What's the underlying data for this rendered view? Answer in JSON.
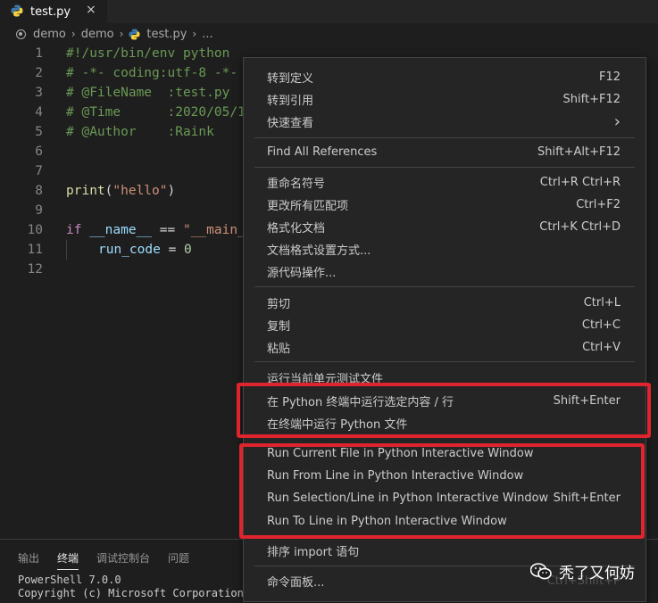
{
  "tab": {
    "title": "test.py",
    "close": "×"
  },
  "breadcrumb": {
    "items": [
      "demo",
      "demo",
      "test.py",
      "..."
    ]
  },
  "editor": {
    "line_numbers": [
      "1",
      "2",
      "3",
      "4",
      "5",
      "6",
      "7",
      "8",
      "9",
      "10",
      "11",
      "12"
    ],
    "lines": {
      "l1": "#!/usr/bin/env python",
      "l2": "# -*- coding:utf-8 -*-",
      "l3": "# @FileName  :test.py",
      "l4": "# @Time      :2020/05/1",
      "l5": "# @Author    :Raink",
      "l8_func": "print",
      "l8_open": "(",
      "l8_str": "\"hello\"",
      "l8_close": ")",
      "l10_kw": "if",
      "l10_var": "__name__",
      "l10_op": " == ",
      "l10_str": "\"__main_",
      "l11_var": "run_code",
      "l11_op": " = ",
      "l11_num": "0"
    }
  },
  "panel": {
    "tabs": [
      "输出",
      "终端",
      "调试控制台",
      "问题"
    ],
    "active_tab": "终端",
    "lines": [
      "PowerShell 7.0.0",
      "Copyright (c) Microsoft Corporation. All r"
    ]
  },
  "context_menu": {
    "items": [
      {
        "label": "转到定义",
        "shortcut": "F12"
      },
      {
        "label": "转到引用",
        "shortcut": "Shift+F12"
      },
      {
        "label": "快速查看",
        "shortcut": "›"
      },
      {
        "label": "Find All References",
        "shortcut": "Shift+Alt+F12"
      },
      {
        "label": "重命名符号",
        "shortcut": "Ctrl+R Ctrl+R"
      },
      {
        "label": "更改所有匹配项",
        "shortcut": "Ctrl+F2"
      },
      {
        "label": "格式化文档",
        "shortcut": "Ctrl+K Ctrl+D"
      },
      {
        "label": "文档格式设置方式...",
        "shortcut": ""
      },
      {
        "label": "源代码操作...",
        "shortcut": ""
      },
      {
        "label": "剪切",
        "shortcut": "Ctrl+L"
      },
      {
        "label": "复制",
        "shortcut": "Ctrl+C"
      },
      {
        "label": "粘贴",
        "shortcut": "Ctrl+V"
      },
      {
        "label": "运行当前单元测试文件",
        "shortcut": ""
      },
      {
        "label": "在 Python 终端中运行选定内容 / 行",
        "shortcut": "Shift+Enter"
      },
      {
        "label": "在终端中运行 Python 文件",
        "shortcut": ""
      },
      {
        "label": "Run Current File in Python Interactive Window",
        "shortcut": ""
      },
      {
        "label": "Run From Line in Python Interactive Window",
        "shortcut": ""
      },
      {
        "label": "Run Selection/Line in Python Interactive Window",
        "shortcut": "Shift+Enter"
      },
      {
        "label": "Run To Line in Python Interactive Window",
        "shortcut": ""
      },
      {
        "label": "排序 import 语句",
        "shortcut": ""
      },
      {
        "label": "命令面板...",
        "shortcut": "Ctrl+Shift+P"
      }
    ]
  },
  "watermark": {
    "text": "秃了又何妨"
  },
  "colors": {
    "highlight_border": "#e0242e",
    "comment": "#6a9955",
    "string": "#ce9178",
    "keyword": "#c586c0"
  }
}
